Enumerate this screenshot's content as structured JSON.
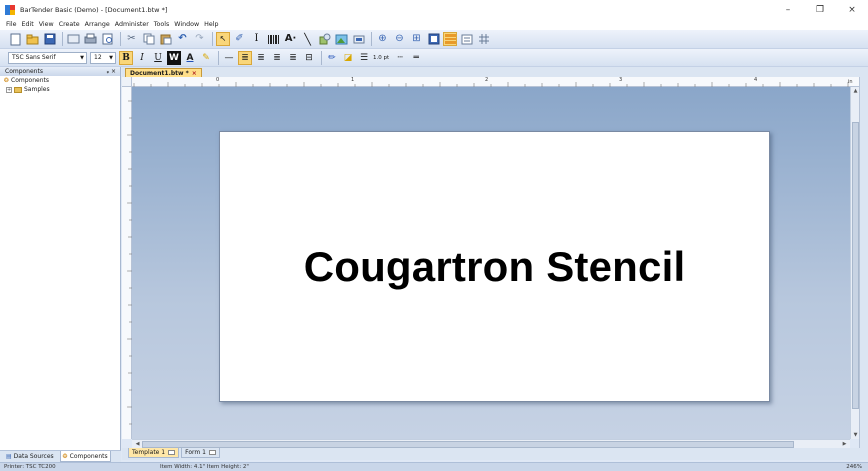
{
  "window": {
    "title": "BarTender Basic (Demo) - [Document1.btw *]",
    "minimize_glyph": "–",
    "restore_glyph": "❐",
    "close_glyph": "×"
  },
  "menu": [
    "File",
    "Edit",
    "View",
    "Create",
    "Arrange",
    "Administer",
    "Tools",
    "Window",
    "Help"
  ],
  "format_toolbar": {
    "font_name": "TSC Sans Serif",
    "font_size": "12",
    "bold": "B",
    "italic": "I",
    "underline": "U",
    "reverse": "W",
    "line_width": "1.0 pt"
  },
  "components_pane": {
    "header": "Components",
    "pin": "ᵩ ×",
    "tree": [
      {
        "label": "Components",
        "icon": "components-icon"
      },
      {
        "label": "Samples",
        "icon": "folder-icon"
      }
    ]
  },
  "left_tabs": [
    {
      "label": "Data Sources",
      "icon": "database-icon"
    },
    {
      "label": "Components",
      "icon": "components-icon"
    }
  ],
  "document_tab": {
    "label": "Document1.btw *",
    "close": "×"
  },
  "ruler": {
    "marks": [
      "0",
      "1",
      "2",
      "3",
      "4"
    ],
    "unit": "in"
  },
  "label": {
    "text": "Cougartron Stencil"
  },
  "template_tabs": [
    {
      "label": "Template 1"
    },
    {
      "label": "Form 1"
    }
  ],
  "status": {
    "printer": "Printer: TSC TC200",
    "item_size": "Item Width: 4.1\"  Item Height: 2\"",
    "zoom": "246%"
  }
}
